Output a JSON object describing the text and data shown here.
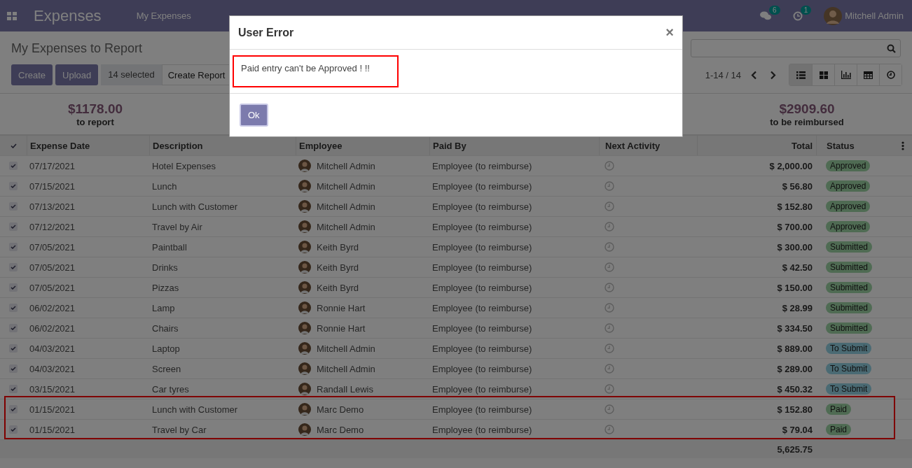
{
  "navbar": {
    "app_name": "Expenses",
    "menu": [
      "My Expenses"
    ],
    "messages_count": "6",
    "activities_count": "1",
    "user": "Mitchell Admin"
  },
  "control_panel": {
    "title": "My Expenses to Report",
    "buttons": [
      "Create",
      "Upload"
    ],
    "selected": "14 selected",
    "create_report": "Create Report",
    "pager": "1-14 / 14",
    "views": [
      {
        "kind": "list",
        "selected": true
      },
      {
        "kind": "kanban",
        "selected": false
      },
      {
        "kind": "graph",
        "selected": false
      },
      {
        "kind": "pivot",
        "selected": false
      },
      {
        "kind": "activity",
        "selected": false
      }
    ]
  },
  "dashboard": [
    {
      "amount": "$1178.00",
      "label": "to report"
    },
    {
      "amount": "$2909.60",
      "label": "to be reimbursed"
    }
  ],
  "table": {
    "all_selected": true,
    "columns": [
      "Expense Date",
      "Description",
      "Employee",
      "Paid By",
      "Next Activity",
      "Total",
      "Status"
    ],
    "rows": [
      {
        "date": "07/17/2021",
        "description": "Hotel Expenses",
        "employee": "Mitchell Admin",
        "paid_by": "Employee (to reimburse)",
        "total": "$ 2,000.00",
        "status": "Approved",
        "checked": true,
        "highlighted": false
      },
      {
        "date": "07/15/2021",
        "description": "Lunch",
        "employee": "Mitchell Admin",
        "paid_by": "Employee (to reimburse)",
        "total": "$ 56.80",
        "status": "Approved",
        "checked": true,
        "highlighted": false
      },
      {
        "date": "07/13/2021",
        "description": "Lunch with Customer",
        "employee": "Mitchell Admin",
        "paid_by": "Employee (to reimburse)",
        "total": "$ 152.80",
        "status": "Approved",
        "checked": true,
        "highlighted": false
      },
      {
        "date": "07/12/2021",
        "description": "Travel by Air",
        "employee": "Mitchell Admin",
        "paid_by": "Employee (to reimburse)",
        "total": "$ 700.00",
        "status": "Approved",
        "checked": true,
        "highlighted": false
      },
      {
        "date": "07/05/2021",
        "description": "Paintball",
        "employee": "Keith Byrd",
        "paid_by": "Employee (to reimburse)",
        "total": "$ 300.00",
        "status": "Submitted",
        "checked": true,
        "highlighted": false
      },
      {
        "date": "07/05/2021",
        "description": "Drinks",
        "employee": "Keith Byrd",
        "paid_by": "Employee (to reimburse)",
        "total": "$ 42.50",
        "status": "Submitted",
        "checked": true,
        "highlighted": false
      },
      {
        "date": "07/05/2021",
        "description": "Pizzas",
        "employee": "Keith Byrd",
        "paid_by": "Employee (to reimburse)",
        "total": "$ 150.00",
        "status": "Submitted",
        "checked": true,
        "highlighted": false
      },
      {
        "date": "06/02/2021",
        "description": "Lamp",
        "employee": "Ronnie Hart",
        "paid_by": "Employee (to reimburse)",
        "total": "$ 28.99",
        "status": "Submitted",
        "checked": true,
        "highlighted": false
      },
      {
        "date": "06/02/2021",
        "description": "Chairs",
        "employee": "Ronnie Hart",
        "paid_by": "Employee (to reimburse)",
        "total": "$ 334.50",
        "status": "Submitted",
        "checked": true,
        "highlighted": false
      },
      {
        "date": "04/03/2021",
        "description": "Laptop",
        "employee": "Mitchell Admin",
        "paid_by": "Employee (to reimburse)",
        "total": "$ 889.00",
        "status": "To Submit",
        "checked": true,
        "highlighted": false
      },
      {
        "date": "04/03/2021",
        "description": "Screen",
        "employee": "Mitchell Admin",
        "paid_by": "Employee (to reimburse)",
        "total": "$ 289.00",
        "status": "To Submit",
        "checked": true,
        "highlighted": false
      },
      {
        "date": "03/15/2021",
        "description": "Car tyres",
        "employee": "Randall Lewis",
        "paid_by": "Employee (to reimburse)",
        "total": "$ 450.32",
        "status": "To Submit",
        "checked": true,
        "highlighted": false
      },
      {
        "date": "01/15/2021",
        "description": "Lunch with Customer",
        "employee": "Marc Demo",
        "paid_by": "Employee (to reimburse)",
        "total": "$ 152.80",
        "status": "Paid",
        "checked": true,
        "highlighted": true
      },
      {
        "date": "01/15/2021",
        "description": "Travel by Car",
        "employee": "Marc Demo",
        "paid_by": "Employee (to reimburse)",
        "total": "$ 79.04",
        "status": "Paid",
        "checked": true,
        "highlighted": true
      }
    ],
    "sum": "5,625.75"
  },
  "dialog": {
    "title": "User Error",
    "close": "×",
    "message": "Paid entry can't be Approved ! !!",
    "message_highlighted": true,
    "button": "Ok"
  }
}
